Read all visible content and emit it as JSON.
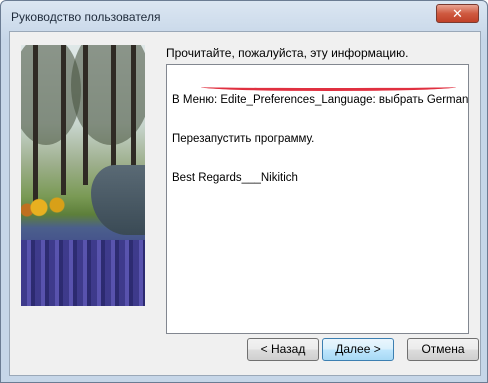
{
  "window": {
    "title": "Руководство пользователя",
    "close_glyph": "✕"
  },
  "content": {
    "prompt": "Прочитайте, пожалуйста, эту информацию.",
    "info_lines": [
      "В Меню: Edite_Preferences_Language: выбрать German.",
      "Перезапустить программу.",
      "Best Regards___Nikitich"
    ]
  },
  "buttons": {
    "back": "< Назад",
    "next": "Далее >",
    "cancel": "Отмена"
  },
  "colors": {
    "annotation_underline": "#e03040"
  }
}
